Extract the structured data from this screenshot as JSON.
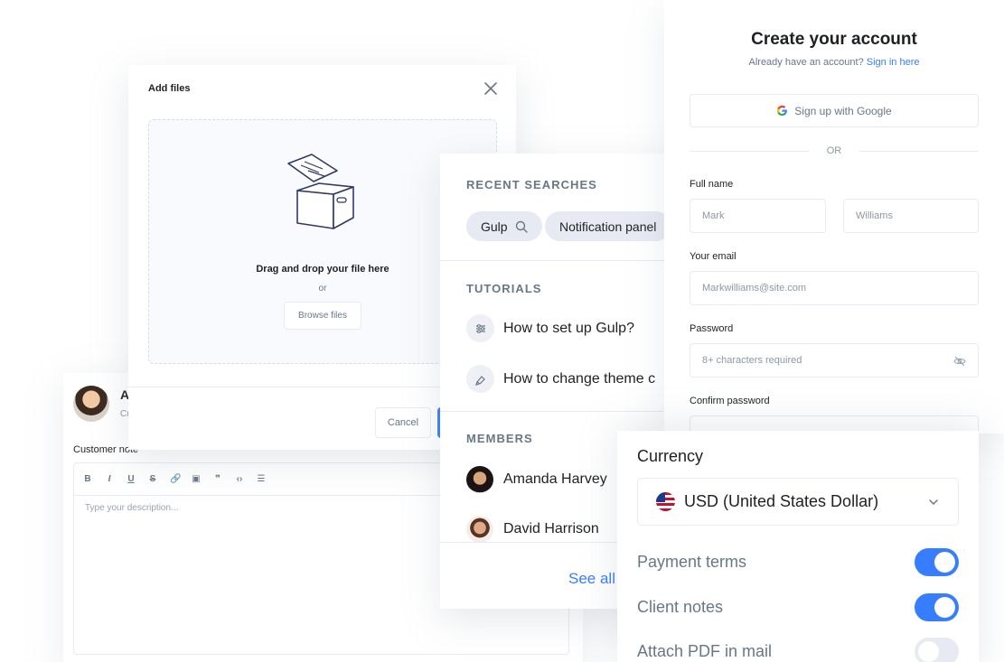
{
  "customer": {
    "name": "A",
    "sub": "Cu",
    "note_label": "Customer note",
    "toolbar": [
      "B",
      "I",
      "U",
      "S",
      "🔗",
      "▣",
      "❞",
      "‹›",
      "☰"
    ],
    "placeholder": "Type your description..."
  },
  "add_files": {
    "title": "Add files",
    "drop_text": "Drag and drop your file here",
    "or": "or",
    "browse": "Browse files",
    "cancel": "Cancel"
  },
  "search_panel": {
    "recent_title": "RECENT SEARCHES",
    "recent": [
      "Gulp",
      "Notification panel"
    ],
    "tutorials_title": "TUTORIALS",
    "tutorials": [
      "How to set up Gulp?",
      "How to change theme c"
    ],
    "members_title": "MEMBERS",
    "members": [
      "Amanda Harvey",
      "David Harrison"
    ],
    "see_all": "See all"
  },
  "account": {
    "title": "Create your account",
    "subtitle": "Already have an account?",
    "signin": "Sign in here",
    "google": "Sign up with Google",
    "or": "OR",
    "fullname_label": "Full name",
    "first_placeholder": "Mark",
    "last_placeholder": "Williams",
    "email_label": "Your email",
    "email_placeholder": "Markwilliams@site.com",
    "password_label": "Password",
    "password_placeholder": "8+ characters required",
    "confirm_label": "Confirm password"
  },
  "currency": {
    "label": "Currency",
    "selected": "USD (United States Dollar)",
    "toggles": [
      {
        "label": "Payment terms",
        "on": true
      },
      {
        "label": "Client notes",
        "on": true
      },
      {
        "label": "Attach PDF in mail",
        "on": false
      }
    ]
  },
  "colors": {
    "accent": "#377dff",
    "muted": "#677788",
    "border": "#e7eaf3"
  },
  "icons": [
    "close-icon",
    "box-icon",
    "search-icon",
    "sliders-icon",
    "brush-icon",
    "google-icon",
    "eye-off-icon",
    "chevron-down-icon",
    "us-flag-icon"
  ]
}
